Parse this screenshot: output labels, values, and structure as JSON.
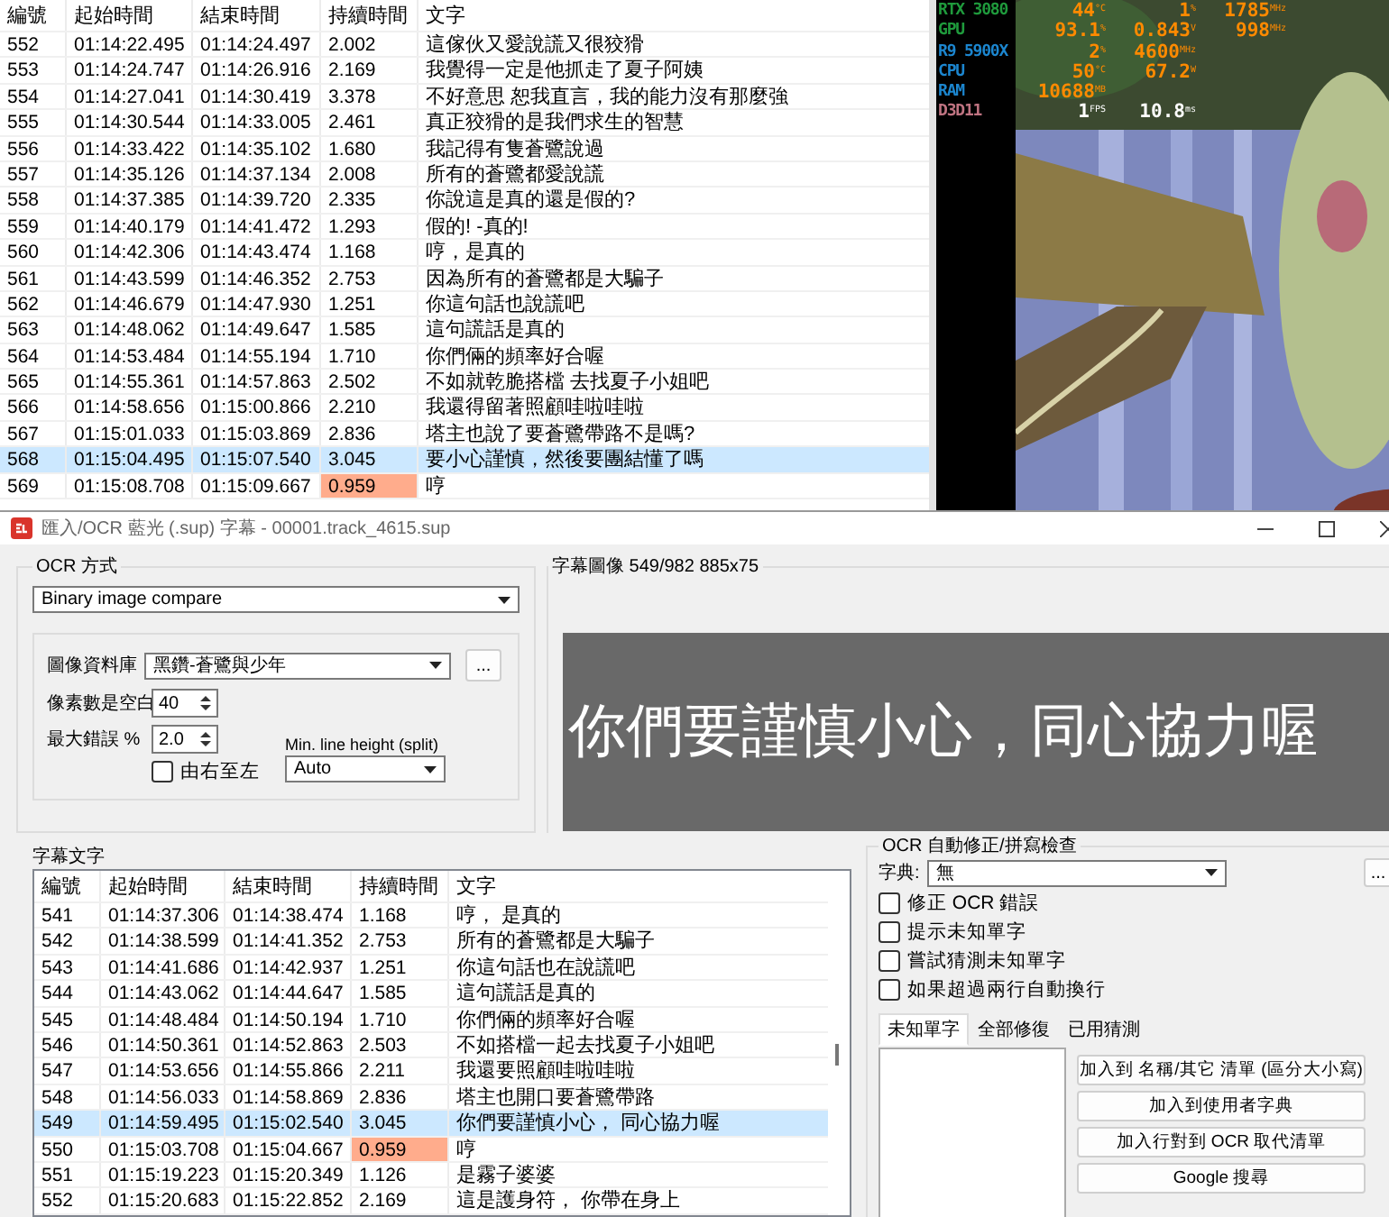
{
  "subtitle_list": {
    "columns": [
      "編號",
      "起始時間",
      "結束時間",
      "持續時間",
      "文字"
    ],
    "rows": [
      {
        "cells": [
          "552",
          "01:14:22.495",
          "01:14:24.497",
          "2.002",
          "這傢伙又愛說謊又很狡猾"
        ],
        "selected": false,
        "warning": false
      },
      {
        "cells": [
          "553",
          "01:14:24.747",
          "01:14:26.916",
          "2.169",
          "我覺得一定是他抓走了夏子阿姨"
        ],
        "selected": false,
        "warning": false
      },
      {
        "cells": [
          "554",
          "01:14:27.041",
          "01:14:30.419",
          "3.378",
          "不好意思 恕我直言，我的能力沒有那麼強"
        ],
        "selected": false,
        "warning": false
      },
      {
        "cells": [
          "555",
          "01:14:30.544",
          "01:14:33.005",
          "2.461",
          "真正狡猾的是我們求生的智慧"
        ],
        "selected": false,
        "warning": false
      },
      {
        "cells": [
          "556",
          "01:14:33.422",
          "01:14:35.102",
          "1.680",
          "我記得有隻蒼鷺說過"
        ],
        "selected": false,
        "warning": false
      },
      {
        "cells": [
          "557",
          "01:14:35.126",
          "01:14:37.134",
          "2.008",
          "所有的蒼鷺都愛說謊"
        ],
        "selected": false,
        "warning": false
      },
      {
        "cells": [
          "558",
          "01:14:37.385",
          "01:14:39.720",
          "2.335",
          "你說這是真的還是假的?"
        ],
        "selected": false,
        "warning": false
      },
      {
        "cells": [
          "559",
          "01:14:40.179",
          "01:14:41.472",
          "1.293",
          "假的! -真的!"
        ],
        "selected": false,
        "warning": false
      },
      {
        "cells": [
          "560",
          "01:14:42.306",
          "01:14:43.474",
          "1.168",
          "哼，是真的"
        ],
        "selected": false,
        "warning": false
      },
      {
        "cells": [
          "561",
          "01:14:43.599",
          "01:14:46.352",
          "2.753",
          "因為所有的蒼鷺都是大騙子"
        ],
        "selected": false,
        "warning": false
      },
      {
        "cells": [
          "562",
          "01:14:46.679",
          "01:14:47.930",
          "1.251",
          "你這句話也說謊吧"
        ],
        "selected": false,
        "warning": false
      },
      {
        "cells": [
          "563",
          "01:14:48.062",
          "01:14:49.647",
          "1.585",
          "這句謊話是真的"
        ],
        "selected": false,
        "warning": false
      },
      {
        "cells": [
          "564",
          "01:14:53.484",
          "01:14:55.194",
          "1.710",
          "你們倆的頻率好合喔"
        ],
        "selected": false,
        "warning": false
      },
      {
        "cells": [
          "565",
          "01:14:55.361",
          "01:14:57.863",
          "2.502",
          "不如就乾脆搭檔 去找夏子小姐吧"
        ],
        "selected": false,
        "warning": false
      },
      {
        "cells": [
          "566",
          "01:14:58.656",
          "01:15:00.866",
          "2.210",
          "我還得留著照顧哇啦哇啦"
        ],
        "selected": false,
        "warning": false
      },
      {
        "cells": [
          "567",
          "01:15:01.033",
          "01:15:03.869",
          "2.836",
          "塔主也說了要蒼鷺帶路不是嗎?"
        ],
        "selected": false,
        "warning": false
      },
      {
        "cells": [
          "568",
          "01:15:04.495",
          "01:15:07.540",
          "3.045",
          "要小心謹慎，然後要團結懂了嗎"
        ],
        "selected": true,
        "warning": false
      },
      {
        "cells": [
          "569",
          "01:15:08.708",
          "01:15:09.667",
          "0.959",
          "哼"
        ],
        "selected": false,
        "warning": true
      }
    ]
  },
  "video": {
    "kind": "picture",
    "osd": [
      {
        "label": "RTX 3080",
        "color": "#1f9a3c",
        "values": [
          {
            "value": "44",
            "unit": "°C",
            "color": "#ff8a00"
          },
          {
            "value": "1",
            "unit": "%",
            "color": "#ff8a00"
          },
          {
            "value": "1785",
            "unit": "MHz",
            "color": "#ff8a00"
          }
        ]
      },
      {
        "label": "GPU",
        "color": "#1f9a3c",
        "values": [
          {
            "value": "93.1",
            "unit": "%",
            "color": "#ff8a00"
          },
          {
            "value": "0.843",
            "unit": "V",
            "color": "#ff8a00"
          },
          {
            "value": "998",
            "unit": "MHz",
            "color": "#ff8a00"
          }
        ]
      },
      {
        "label": "R9 5900X",
        "color": "#1c86cf",
        "values": [
          {
            "value": "2",
            "unit": "%",
            "color": "#ff8a00"
          },
          {
            "value": "4600",
            "unit": "MHz",
            "color": "#ff8a00"
          }
        ]
      },
      {
        "label": "CPU",
        "color": "#1c86cf",
        "values": [
          {
            "value": "50",
            "unit": "°C",
            "color": "#ff8a00"
          },
          {
            "value": "67.2",
            "unit": "W",
            "color": "#ff8a00"
          }
        ]
      },
      {
        "label": "RAM",
        "color": "#1c86cf",
        "values": [
          {
            "value": "10688",
            "unit": "MB",
            "color": "#ff8a00"
          }
        ]
      },
      {
        "label": "D3D11",
        "color": "#c07482",
        "values": [
          {
            "value": "1",
            "unit": "FPS",
            "color": "#ffffff"
          },
          {
            "value": "10.8",
            "unit": "ms",
            "color": "#ffffff"
          }
        ]
      }
    ]
  },
  "dialog": {
    "title": "匯入/OCR 藍光 (.sup) 字幕 - 00001.track_4615.sup",
    "ocr_method": {
      "title": "OCR 方式",
      "method": "Binary image compare",
      "image_db": {
        "label": "圖像資料庫",
        "value": "黑鑽-蒼鷺與少年",
        "button": "..."
      },
      "pixels_space": {
        "label": "像素數是空白",
        "value": "40"
      },
      "max_error": {
        "label": "最大錯誤 %",
        "value": "2.0"
      },
      "right_to_left": {
        "label": "由右至左",
        "checked": false
      },
      "min_line_height": {
        "label": "Min. line height (split)",
        "value": "Auto"
      }
    },
    "subtitle_image": {
      "title": "字幕圖像",
      "info": "549/982   885x75",
      "text": "你們要謹慎小心，同心協力喔"
    },
    "subtitle_text": {
      "title": "字幕文字",
      "columns": [
        "編號",
        "起始時間",
        "結束時間",
        "持續時間",
        "文字"
      ],
      "rows": [
        {
          "cells": [
            "541",
            "01:14:37.306",
            "01:14:38.474",
            "1.168",
            "哼， 是真的"
          ],
          "selected": false,
          "warning": false
        },
        {
          "cells": [
            "542",
            "01:14:38.599",
            "01:14:41.352",
            "2.753",
            "所有的蒼鷺都是大騙子"
          ],
          "selected": false,
          "warning": false
        },
        {
          "cells": [
            "543",
            "01:14:41.686",
            "01:14:42.937",
            "1.251",
            "你這句話也在說謊吧"
          ],
          "selected": false,
          "warning": false
        },
        {
          "cells": [
            "544",
            "01:14:43.062",
            "01:14:44.647",
            "1.585",
            "這句謊話是真的"
          ],
          "selected": false,
          "warning": false
        },
        {
          "cells": [
            "545",
            "01:14:48.484",
            "01:14:50.194",
            "1.710",
            "你們倆的頻率好合喔"
          ],
          "selected": false,
          "warning": false
        },
        {
          "cells": [
            "546",
            "01:14:50.361",
            "01:14:52.863",
            "2.503",
            "不如搭檔一起去找夏子小姐吧"
          ],
          "selected": false,
          "warning": false
        },
        {
          "cells": [
            "547",
            "01:14:53.656",
            "01:14:55.866",
            "2.211",
            "我還要照顧哇啦哇啦"
          ],
          "selected": false,
          "warning": false
        },
        {
          "cells": [
            "548",
            "01:14:56.033",
            "01:14:58.869",
            "2.836",
            "塔主也開口要蒼鷺帶路"
          ],
          "selected": false,
          "warning": false
        },
        {
          "cells": [
            "549",
            "01:14:59.495",
            "01:15:02.540",
            "3.045",
            "你們要謹慎小心， 同心協力喔"
          ],
          "selected": true,
          "warning": false
        },
        {
          "cells": [
            "550",
            "01:15:03.708",
            "01:15:04.667",
            "0.959",
            "哼"
          ],
          "selected": false,
          "warning": true
        },
        {
          "cells": [
            "551",
            "01:15:19.223",
            "01:15:20.349",
            "1.126",
            "是霧子婆婆"
          ],
          "selected": false,
          "warning": false
        },
        {
          "cells": [
            "552",
            "01:15:20.683",
            "01:15:22.852",
            "2.169",
            "這是護身符， 你帶在身上"
          ],
          "selected": false,
          "warning": false
        }
      ]
    },
    "spellcheck": {
      "title": "OCR 自動修正/拼寫檢查",
      "dictionary": {
        "label": "字典:",
        "value": "無",
        "button": "..."
      },
      "options": [
        {
          "label": "修正 OCR 錯誤",
          "checked": false
        },
        {
          "label": "提示未知單字",
          "checked": false
        },
        {
          "label": "嘗試猜測未知單字",
          "checked": false
        },
        {
          "label": "如果超過兩行自動換行",
          "checked": false
        }
      ],
      "tabs": [
        {
          "label": "未知單字",
          "selected": true
        },
        {
          "label": "全部修復",
          "selected": false
        },
        {
          "label": "已用猜測",
          "selected": false
        }
      ],
      "buttons": [
        "加入到 名稱/其它 清單 (區分大小寫)",
        "加入到使用者字典",
        "加入行對到 OCR 取代清單",
        "Google 搜尋"
      ]
    }
  }
}
